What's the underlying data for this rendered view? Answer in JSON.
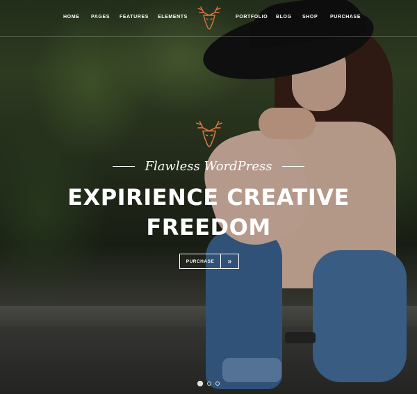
{
  "nav": {
    "left_items": [
      {
        "label": "HOME"
      },
      {
        "label": "PAGES"
      },
      {
        "label": "FEATURES"
      },
      {
        "label": "ELEMENTS"
      }
    ],
    "right_items": [
      {
        "label": "PORTFOLIO"
      },
      {
        "label": "BLOG"
      },
      {
        "label": "SHOP"
      },
      {
        "label": "PURCHASE"
      }
    ],
    "logo_icon": "deer-head-icon"
  },
  "hero": {
    "logo_icon": "deer-head-icon",
    "tagline": "Flawless WordPress",
    "headline_line1": "EXPIRIENCE CREATIVE",
    "headline_line2": "FREEDOM",
    "purchase_button": "PURCHASE",
    "arrow_icon": "double-chevron-right-icon",
    "arrow_glyph": "»"
  },
  "slider": {
    "dot_count": 3,
    "active_index": 0
  },
  "colors": {
    "accent": "#d9773f",
    "text": "#ffffff"
  }
}
